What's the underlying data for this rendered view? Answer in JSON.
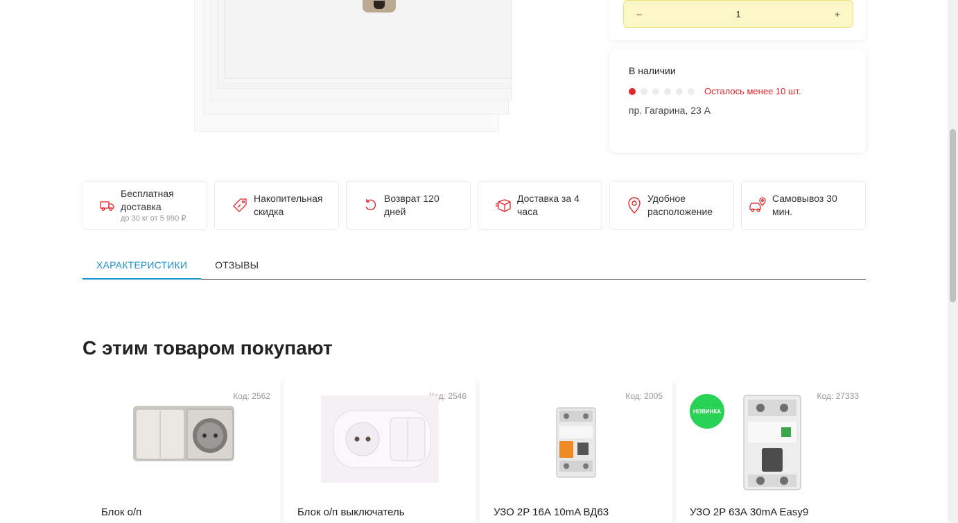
{
  "quantity": {
    "minus": "–",
    "value": "1",
    "plus": "+"
  },
  "stock": {
    "title": "В наличии",
    "level": 1,
    "level_max": 6,
    "warning": "Осталось менее 10 шт.",
    "address": "пр. Гагарина, 23 А"
  },
  "features": [
    {
      "icon": "truck-icon",
      "text": "Бесплатная доставка",
      "sub": "до 30 кг от 5 990 ₽"
    },
    {
      "icon": "discount-tag-icon",
      "text": "Накопительная скидка"
    },
    {
      "icon": "return-icon",
      "text": "Возврат 120 дней"
    },
    {
      "icon": "box-icon",
      "text": "Доставка за 4 часа"
    },
    {
      "icon": "location-pin-icon",
      "text": "Удобное расположение"
    },
    {
      "icon": "car-pin-icon",
      "text": "Самовывоз 30 мин."
    }
  ],
  "tabs": [
    {
      "label": "ХАРАКТЕРИСТИКИ",
      "active": true
    },
    {
      "label": "ОТЗЫВЫ",
      "active": false
    }
  ],
  "related": {
    "title": "С этим товаром покупают",
    "items": [
      {
        "code": "Код: 2562",
        "name": "Блок о/п"
      },
      {
        "code": "Код: 2546",
        "name": "Блок о/п выключатель"
      },
      {
        "code": "Код: 2005",
        "name": "УЗО 2P 16А 10mA ВД63"
      },
      {
        "code": "Код: 27333",
        "name": "УЗО 2P 63А 30mA Easy9",
        "badge": "НОВИНКА"
      }
    ]
  },
  "colors": {
    "accent": "#1f8fd1",
    "warning": "#e2252a",
    "badge": "#27d254",
    "qty_bg": "#fbf7c6"
  }
}
